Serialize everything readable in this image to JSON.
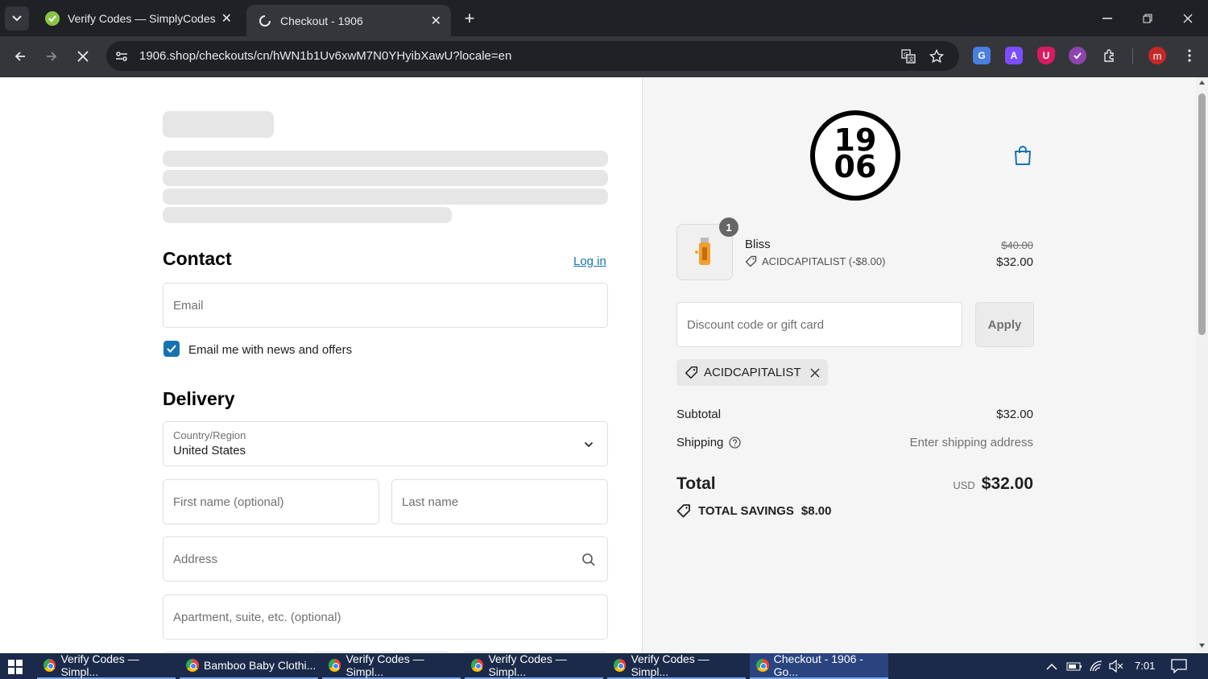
{
  "browser": {
    "tabs": [
      {
        "title": "Verify Codes — SimplyCodes",
        "active": false
      },
      {
        "title": "Checkout - 1906",
        "active": true
      }
    ],
    "url": "1906.shop/checkouts/cn/hWN1b1Uv6xwM7N0YHyibXawU?locale=en",
    "profile_initial": "m",
    "ext_a": "A",
    "ext_u": "U"
  },
  "contact": {
    "heading": "Contact",
    "login_label": "Log in",
    "email_placeholder": "Email",
    "newsletter_label": "Email me with news and offers",
    "newsletter_checked": true
  },
  "delivery": {
    "heading": "Delivery",
    "country_label": "Country/Region",
    "country_value": "United States",
    "first_name_placeholder": "First name (optional)",
    "last_name_placeholder": "Last name",
    "address_placeholder": "Address",
    "apartment_placeholder": "Apartment, suite, etc. (optional)"
  },
  "summary": {
    "logo_line1": "19",
    "logo_line2": "06",
    "item": {
      "qty": "1",
      "name": "Bliss",
      "discount": "ACIDCAPITALIST (-$8.00)",
      "original_price": "$40.00",
      "price": "$32.00"
    },
    "discount_placeholder": "Discount code or gift card",
    "apply_label": "Apply",
    "applied_code": "ACIDCAPITALIST",
    "subtotal_label": "Subtotal",
    "subtotal_value": "$32.00",
    "shipping_label": "Shipping",
    "shipping_value": "Enter shipping address",
    "total_label": "Total",
    "currency": "USD",
    "total_value": "$32.00",
    "savings_label": "TOTAL SAVINGS",
    "savings_value": "$8.00"
  },
  "taskbar": {
    "items": [
      "Verify Codes — Simpl...",
      "Bamboo Baby Clothi...",
      "Verify Codes — Simpl...",
      "Verify Codes — Simpl...",
      "Verify Codes — Simpl...",
      "Checkout - 1906 - Go..."
    ],
    "time": "7:01"
  },
  "colors": {
    "accent": "#1773b0",
    "tabbar": "#202124",
    "toolbar": "#35363a",
    "taskbar": "#1b2a4a"
  }
}
